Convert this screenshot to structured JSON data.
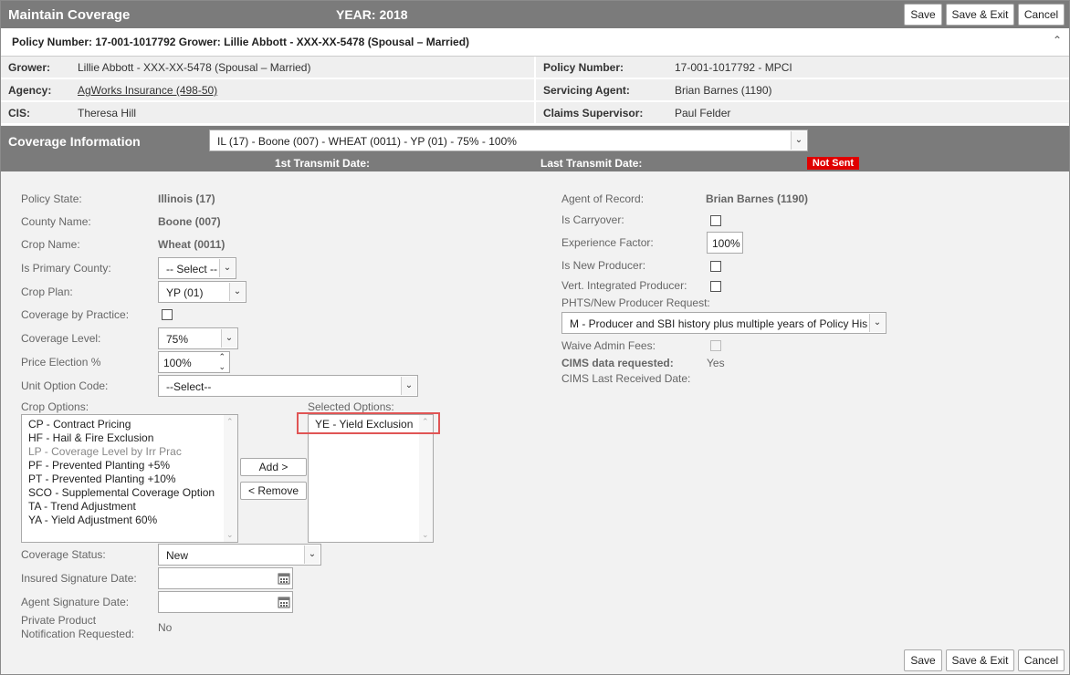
{
  "header": {
    "title": "Maintain Coverage",
    "year": "YEAR: 2018",
    "buttons": {
      "save": "Save",
      "save_exit": "Save & Exit",
      "cancel": "Cancel"
    }
  },
  "policy_bar": {
    "text": "Policy Number: 17-001-1017792 Grower: Lillie Abbott - XXX-XX-5478 (Spousal – Married)",
    "toggle_icon": "chevron-up-icon"
  },
  "info": {
    "grower_label": "Grower:",
    "grower": "Lillie Abbott - XXX-XX-5478 (Spousal – Married)",
    "agency_label": "Agency:",
    "agency": "AgWorks Insurance (498-50)",
    "cis_label": "CIS:",
    "cis": "Theresa Hill",
    "policy_number_label": "Policy Number:",
    "policy_number": "17-001-1017792 - MPCI",
    "servicing_agent_label": "Servicing Agent:",
    "servicing_agent": "Brian Barnes (1190)",
    "claims_supervisor_label": "Claims Supervisor:",
    "claims_supervisor": "Paul Felder"
  },
  "coverage": {
    "title": "Coverage Information",
    "selected_coverage": "IL (17) - Boone (007) - WHEAT (0011) - YP (01) - 75% - 100%",
    "first_transmit_label": "1st Transmit Date:",
    "last_transmit_label": "Last Transmit Date:",
    "status_badge": "Not Sent"
  },
  "form_left": {
    "policy_state_label": "Policy State:",
    "policy_state": "Illinois (17)",
    "county_label": "County Name:",
    "county": "Boone (007)",
    "crop_label": "Crop Name:",
    "crop": "Wheat (0011)",
    "primary_county_label": "Is Primary County:",
    "primary_county": "-- Select --",
    "crop_plan_label": "Crop Plan:",
    "crop_plan": "YP (01)",
    "coverage_by_practice_label": "Coverage by Practice:",
    "coverage_level_label": "Coverage Level:",
    "coverage_level": "75%",
    "price_election_label": "Price Election %",
    "price_election": "100%",
    "unit_option_label": "Unit Option Code:",
    "unit_option": "--Select--",
    "crop_options_label": "Crop Options:",
    "crop_options": [
      {
        "label": "CP - Contract Pricing",
        "disabled": false
      },
      {
        "label": "HF - Hail & Fire Exclusion",
        "disabled": false
      },
      {
        "label": "LP - Coverage Level by Irr Prac",
        "disabled": true
      },
      {
        "label": "PF - Prevented Planting +5%",
        "disabled": false
      },
      {
        "label": "PT - Prevented Planting +10%",
        "disabled": false
      },
      {
        "label": "SCO - Supplemental Coverage Option",
        "disabled": false
      },
      {
        "label": "TA - Trend Adjustment",
        "disabled": false
      },
      {
        "label": "YA - Yield Adjustment 60%",
        "disabled": false
      }
    ],
    "add_button": "Add >",
    "remove_button": "< Remove",
    "selected_options_label": "Selected Options:",
    "selected_options": [
      "YE - Yield Exclusion"
    ],
    "coverage_status_label": "Coverage Status:",
    "coverage_status": "New",
    "insured_sig_label": "Insured Signature Date:",
    "agent_sig_label": "Agent Signature Date:",
    "private_product_label_1": "Private Product",
    "private_product_label_2": "Notification Requested:",
    "private_product": "No"
  },
  "form_right": {
    "agent_of_record_label": "Agent of Record:",
    "agent_of_record": "Brian Barnes (1190)",
    "carryover_label": "Is Carryover:",
    "experience_factor_label": "Experience Factor:",
    "experience_factor": "100%",
    "new_producer_label": "Is New Producer:",
    "vert_integrated_label": "Vert. Integrated Producer:",
    "phts_label": "PHTS/New Producer Request:",
    "phts": "M - Producer and SBI history plus multiple years of Policy History",
    "waive_admin_label": "Waive Admin Fees:",
    "cims_requested_label": "CIMS data requested:",
    "cims_requested": "Yes",
    "cims_last_received_label": "CIMS Last Received Date:"
  }
}
